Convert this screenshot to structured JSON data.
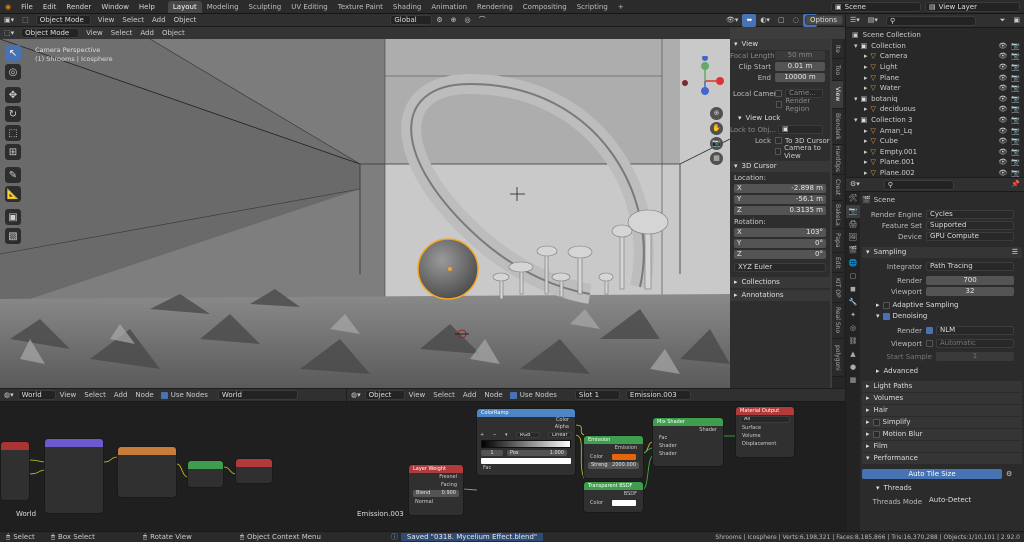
{
  "menu": [
    "File",
    "Edit",
    "Render",
    "Window",
    "Help"
  ],
  "workspaces": [
    "Layout",
    "Modeling",
    "Sculpting",
    "UV Editing",
    "Texture Paint",
    "Shading",
    "Animation",
    "Rendering",
    "Compositing",
    "Scripting"
  ],
  "active_workspace": "Layout",
  "scene_name": "Scene",
  "view_layer": "View Layer",
  "viewport": {
    "mode": "Object Mode",
    "menus": [
      "View",
      "Select",
      "Add",
      "Object"
    ],
    "orientation": "Global",
    "options": "Options",
    "overlay_line1": "Camera Perspective",
    "overlay_line2": "(1) Shrooms | Icosphere"
  },
  "n_panel": {
    "tabs": [
      "Ite",
      "Too",
      "View",
      "Blenderk",
      "HardOps",
      "Creat",
      "BakeLa",
      "Papa",
      "Edit",
      "KIT OP",
      "Real Sno",
      "polygoni"
    ],
    "view": {
      "title": "View",
      "focal_length_label": "Focal Length",
      "focal_length": "50 mm",
      "clip_start_label": "Clip Start",
      "clip_start": "0.01 m",
      "end_label": "End",
      "end": "10000 m",
      "local_camera_label": "Local Camera",
      "local_camera": "Came...",
      "render_region": "Render Region",
      "view_lock": "View Lock",
      "lock_to_obj": "Lock to Obj...",
      "lock_label": "Lock",
      "to_3d_cursor": "To 3D Cursor",
      "camera_to_view": "Camera to View"
    },
    "cursor": {
      "title": "3D Cursor",
      "location_label": "Location:",
      "x_label": "X",
      "x": "-2.898 m",
      "y_label": "Y",
      "y": "-56.1 m",
      "z_label": "Z",
      "z": "0.3135 m",
      "rotation_label": "Rotation:",
      "rx": "103°",
      "ry": "0°",
      "rz": "0°",
      "rot_mode": "XYZ Euler"
    },
    "collections": "Collections",
    "annotations": "Annotations"
  },
  "outliner": {
    "title": "Scene Collection",
    "items": [
      {
        "name": "Collection",
        "indent": 0
      },
      {
        "name": "Camera",
        "indent": 1
      },
      {
        "name": "Light",
        "indent": 1
      },
      {
        "name": "Plane",
        "indent": 1
      },
      {
        "name": "Water",
        "indent": 1
      },
      {
        "name": "botaniq",
        "indent": 0
      },
      {
        "name": "deciduous",
        "indent": 1
      },
      {
        "name": "Collection 3",
        "indent": 0
      },
      {
        "name": "Aman_Lq",
        "indent": 1
      },
      {
        "name": "Cube",
        "indent": 1
      },
      {
        "name": "Empty.001",
        "indent": 1
      },
      {
        "name": "Plane.001",
        "indent": 1
      },
      {
        "name": "Plane.002",
        "indent": 1
      }
    ]
  },
  "properties": {
    "scene": "Scene",
    "render_engine_label": "Render Engine",
    "render_engine": "Cycles",
    "feature_set_label": "Feature Set",
    "feature_set": "Supported",
    "device_label": "Device",
    "device": "GPU Compute",
    "sampling": "Sampling",
    "integrator_label": "Integrator",
    "integrator": "Path Tracing",
    "render_label": "Render",
    "render_samples": "700",
    "viewport_label": "Viewport",
    "viewport_samples": "32",
    "adaptive": "Adaptive Sampling",
    "denoising": "Denoising",
    "denoise_render_label": "Render",
    "denoise_render": "NLM",
    "denoise_viewport_label": "Viewport",
    "denoise_viewport": "Automatic",
    "start_sample_label": "Start Sample",
    "start_sample": "1",
    "advanced": "Advanced",
    "light_paths": "Light Paths",
    "volumes": "Volumes",
    "hair": "Hair",
    "simplify": "Simplify",
    "motion_blur": "Motion Blur",
    "film": "Film",
    "performance": "Performance",
    "auto_tile": "Auto Tile Size",
    "threads": "Threads",
    "threads_mode_label": "Threads Mode",
    "threads_mode": "Auto-Detect"
  },
  "world_editor": {
    "type": "World",
    "menus": [
      "View",
      "Select",
      "Add",
      "Node"
    ],
    "use_nodes": "Use Nodes",
    "world": "World",
    "label": "World"
  },
  "shader_editor": {
    "type": "Object",
    "menus": [
      "View",
      "Select",
      "Add",
      "Node"
    ],
    "use_nodes": "Use Nodes",
    "slot": "Slot 1",
    "material": "Emission.003",
    "label": "Emission.003",
    "nodes": {
      "colorramp": {
        "title": "ColorRamp",
        "color": "Color",
        "alpha": "Alpha",
        "mode": "RGB",
        "interp": "Linear",
        "index": "1",
        "pos_label": "Pos",
        "pos": "1.000",
        "fac": "Fac"
      },
      "layer_weight": {
        "title": "Layer Weight",
        "fresnel": "Fresnel",
        "facing": "Facing",
        "blend_label": "Blend",
        "blend": "0.900",
        "normal": "Normal"
      },
      "emission": {
        "title": "Emission",
        "emission": "Emission",
        "color": "Color",
        "strength_label": "Streng",
        "strength": "2000.000"
      },
      "transparent": {
        "title": "Transparent BSDF",
        "bsdf": "BSDF",
        "color": "Color"
      },
      "mix": {
        "title": "Mix Shader",
        "shader": "Shader",
        "fac": "Fac",
        "in1": "Shader",
        "in2": "Shader"
      },
      "output": {
        "title": "Material Output",
        "target": "All",
        "surface": "Surface",
        "volume": "Volume",
        "displacement": "Displacement"
      }
    }
  },
  "status": {
    "select": "Select",
    "box_select": "Box Select",
    "rotate": "Rotate View",
    "context": "Object Context Menu",
    "saved": "Saved \"0318. Mycelium Effect.blend\"",
    "stats": "Shrooms | Icosphere | Verts:6,198,321 | Faces:8,185,866 | Tris:16,370,288 | Objects:1/10,101 | 2.92.0"
  }
}
